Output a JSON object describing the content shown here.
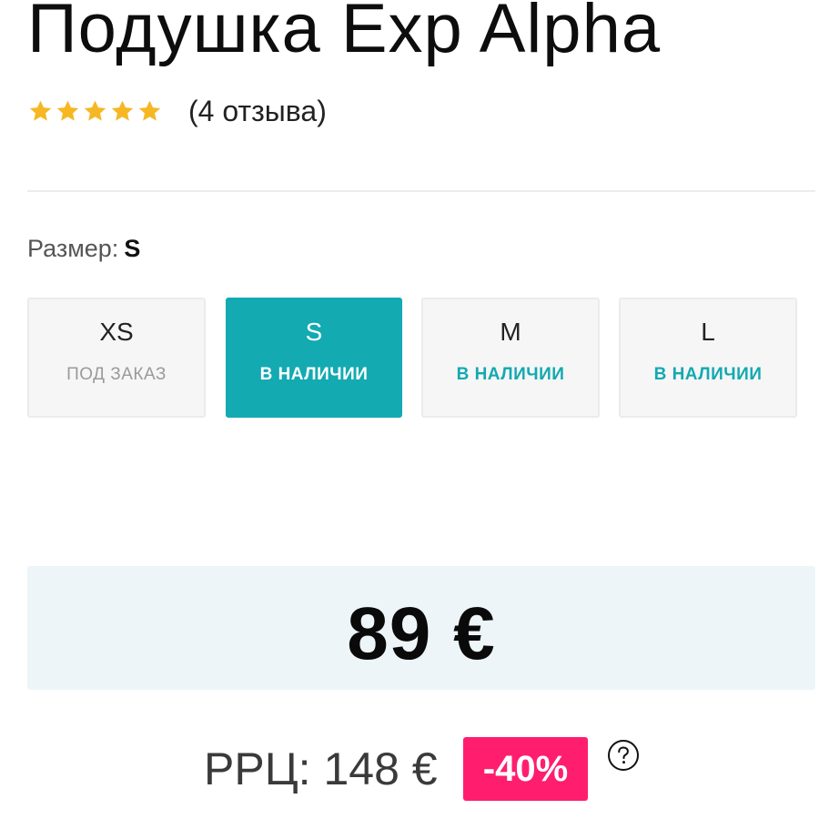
{
  "product": {
    "title": "Подушка Exp Alpha",
    "rating": 5,
    "rating_max": 5,
    "reviews_text": "(4 отзыва)"
  },
  "size_selector": {
    "label": "Размер:",
    "selected": "S",
    "options": [
      {
        "size": "XS",
        "status": "ПОД ЗАКАЗ"
      },
      {
        "size": "S",
        "status": "В НАЛИЧИИ"
      },
      {
        "size": "M",
        "status": "В НАЛИЧИИ"
      },
      {
        "size": "L",
        "status": "В НАЛИЧИИ"
      }
    ]
  },
  "pricing": {
    "price": "89 €",
    "rrp": "РРЦ: 148 €",
    "discount": "-40%"
  },
  "colors": {
    "accent": "#13aab2",
    "discount": "#ff1e6e",
    "star": "#f5b824",
    "price_bg": "#eef5f8"
  },
  "icons": {
    "star": "star-icon",
    "help": "question-circle-icon"
  }
}
